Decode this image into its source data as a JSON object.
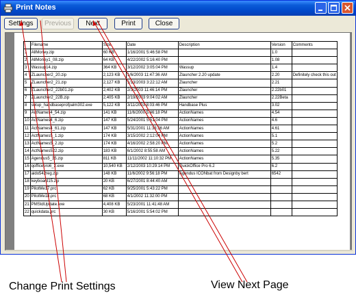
{
  "window": {
    "title": "Print Notes"
  },
  "toolbar": {
    "settings_label": "Settings",
    "previous_label": "Previous",
    "next_label": "Next",
    "print_label": "Print",
    "close_label": "Close"
  },
  "table": {
    "headers": [
      "",
      "Filename",
      "Size",
      "Date",
      "Description",
      "Version",
      "Comments"
    ],
    "rows": [
      [
        "1",
        "AllMoney.zip",
        "60 KB",
        "1/16/2001 5:46:58 PM",
        "",
        "1.0",
        ""
      ],
      [
        "2",
        "AllMoney1_08.zip",
        "64 KB",
        "4/22/2002 5:16:40 PM",
        "",
        "1.08",
        ""
      ],
      [
        "3",
        "Wassup14.zip",
        "364 KB",
        "3/12/2002 3:05:04 PM",
        "Wassup",
        "1.4",
        ""
      ],
      [
        "4",
        "ZLauncher2_20.zip",
        "2,123 KB",
        "1/6/2003 11:47:36 AM",
        "Zlauncher 2.20 update",
        "2.20",
        "Definitely check this out"
      ],
      [
        "5",
        "ZLauncher2_21.zip",
        "2,127 KB",
        "1/13/2003 3:22:12 AM",
        "Zlauncher",
        "2.21",
        ""
      ],
      [
        "6",
        "ZLauncher2_22b01.zip",
        "2,402 KB",
        "2/3/2003 11:46:14 PM",
        "Zlauncher",
        "2.22b01",
        ""
      ],
      [
        "7",
        "ZLauncher2_22B.zip",
        "2,405 KB",
        "2/19/2003 9:04:02 AM",
        "Zlauncher",
        "2.22Beta",
        ""
      ],
      [
        "8",
        "setup_handbaseprofpalm302.exe",
        "5,122 KB",
        "3/11/2003 8:03:46 PM",
        "Handbase Plus",
        "3.02",
        ""
      ],
      [
        "9",
        "ActNames4_54.zip",
        "141 KB",
        "11/6/2000 5:46:18 PM",
        "ActionNames",
        "4.54",
        ""
      ],
      [
        "10",
        "ActNames4_6.zip",
        "147 KB",
        "5/24/2001 5:51:04 PM",
        "ActionNames",
        "4.6",
        ""
      ],
      [
        "11",
        "ActNames4_61.zip",
        "147 KB",
        "5/31/2001 11:33:36 AM",
        "ActionNames",
        "4.61",
        ""
      ],
      [
        "12",
        "ActNames5_1.zip",
        "174 KB",
        "3/15/2002 2:12:04 PM",
        "ActionNames",
        "5.1",
        ""
      ],
      [
        "13",
        "ActNames5_2.zip",
        "174 KB",
        "4/16/2002 2:58:20 PM",
        "ActionNames",
        "5.2",
        ""
      ],
      [
        "14",
        "ActNames522.zip",
        "183 KB",
        "6/1/2002 8:55:58 AM",
        "ActionNames",
        "5.22",
        ""
      ],
      [
        "15",
        "Agendus5_35.zip",
        "811 KB",
        "11/11/2002 11:10:32 PM",
        "ActionNames",
        "5.35",
        ""
      ],
      [
        "16",
        "qofficepro6_2.exe",
        "10,540 KB",
        "2/12/2003 10:29:14 PM",
        "QuickOffice Pro 6.2",
        "6.2",
        ""
      ],
      [
        "17",
        "aido542reg.zip",
        "148 KB",
        "11/6/2002 9:56:18 PM",
        "Agendus ICONbat from Designby bert",
        "6542",
        ""
      ],
      [
        "18",
        "keyboard15.zip",
        "20 KB",
        "6/27/2001 8:44:40 AM",
        "",
        "",
        ""
      ],
      [
        "19",
        "PilotMe17.prc",
        "62 KB",
        "9/25/2001 5:43:22 PM",
        "",
        "",
        ""
      ],
      [
        "20",
        "PilotMe18.prc",
        "68 KB",
        "4/1/2002 11:32:00 PM",
        "",
        "",
        ""
      ],
      [
        "21",
        "PMStdUpdate.exe",
        "4,408 KB",
        "5/23/2001 11:41:48 AM",
        "",
        "",
        ""
      ],
      [
        "22",
        "quickdata.prc",
        "30 KB",
        "5/16/2001 5:54:02 PM",
        "",
        "",
        ""
      ]
    ]
  },
  "callouts": {
    "change_settings": "Change Print Settings",
    "view_next": "View Next Page"
  },
  "colors": {
    "titlebar": "#0a5bd8",
    "window_bg": "#ece9d8",
    "preview_bg": "#808080",
    "arrow": "#cc0000"
  },
  "icons": {
    "title": "printer-icon",
    "minimize": "minimize-icon",
    "maximize": "maximize-icon",
    "close": "close-icon"
  }
}
